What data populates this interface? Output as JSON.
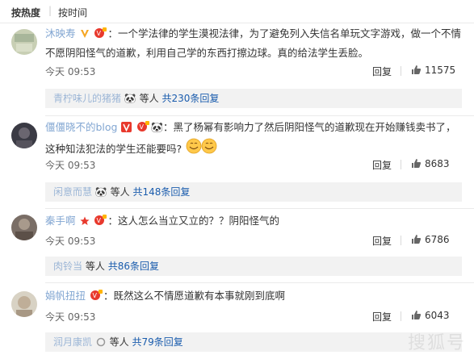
{
  "sort": {
    "hot": "按热度",
    "time": "按时间"
  },
  "comments": [
    {
      "user": "沐映寿",
      "text": "：一个学法律的学生漠视法律，为了避免列入失信名单玩文字游戏，做一个不情不愿阴阳怪气的道歉，利用自己学的东西打擦边球。真的给法学生丢脸。",
      "time": "今天 09:53",
      "reply": "回复",
      "likes": "11575",
      "thread_user": "青柠味儿的猪猪",
      "thread_emoji": "🐼",
      "thread_prefix": "等人",
      "thread_link": "共230条回复"
    },
    {
      "user": "僵僵晓不的blog",
      "inline_emoji": "🐼",
      "text": "：黑了杨幂有影响力了然后阴阳怪气的道歉现在开始赚钱卖书了，这种知法犯法的学生还能要吗?",
      "time": "今天 09:53",
      "reply": "回复",
      "likes": "8683",
      "thread_user": "闲意而慧",
      "thread_emoji": "🐼",
      "thread_prefix": "等人",
      "thread_link": "共148条回复"
    },
    {
      "user": "秦手啊",
      "text": "：这人怎么当立又立的？？阴阳怪气的",
      "time": "今天 09:53",
      "reply": "回复",
      "likes": "6786",
      "thread_user": "肉铃当",
      "thread_prefix": "等人",
      "thread_link": "共86条回复"
    },
    {
      "user": "娟帆扭扭",
      "text": "：既然这么不情愿道歉有本事就刚到底啊",
      "time": "今天 09:53",
      "reply": "回复",
      "likes": "6043",
      "thread_user": "润月康凯",
      "thread_prefix": "等人",
      "thread_link": "共79条回复"
    }
  ],
  "watermark": "搜狐号"
}
